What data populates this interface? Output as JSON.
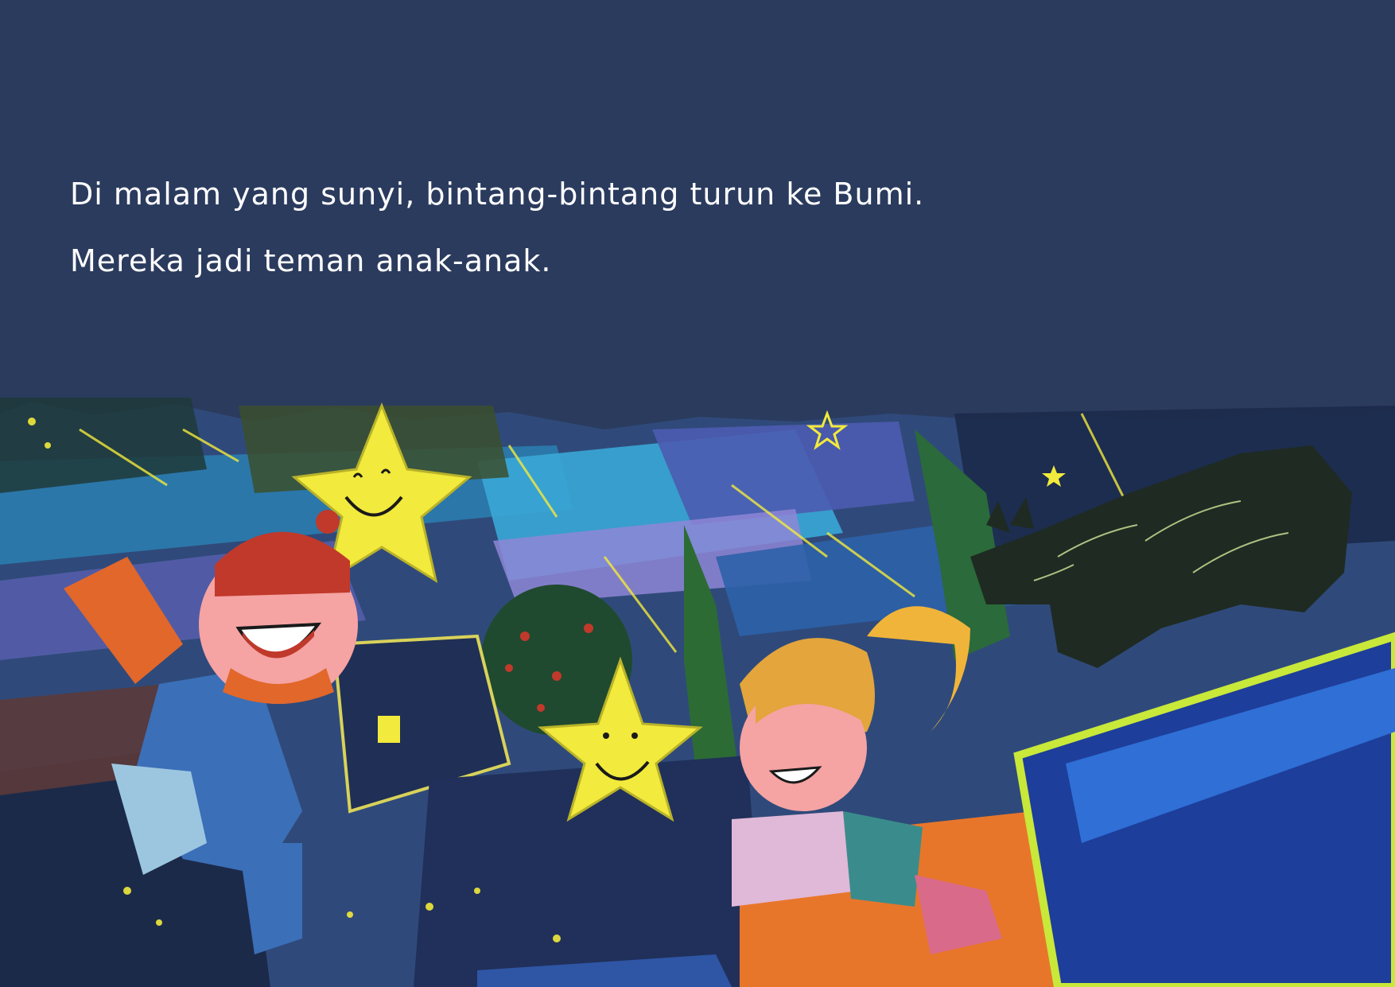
{
  "story": {
    "lines": [
      "Di malam yang sunyi, bintang-bintang turun ke Bumi.",
      "Mereka jadi teman anak-anak."
    ]
  },
  "colors": {
    "background": "#2b3b5e",
    "text": "#ffffff",
    "star": "#f2ea3c",
    "hat": "#c0392b",
    "scarf": "#e2672a",
    "cat": "#1f2a22"
  }
}
